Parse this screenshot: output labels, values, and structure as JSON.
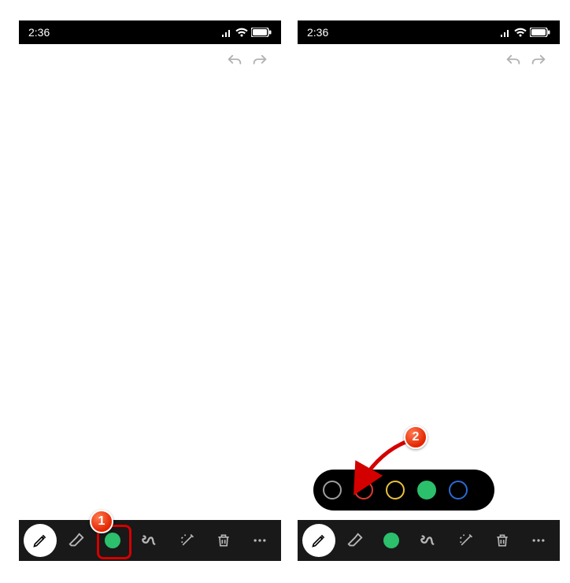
{
  "statusbar": {
    "time": "2:36"
  },
  "toolbar": {
    "tools": [
      "pencil",
      "eraser",
      "color",
      "squiggle",
      "magic",
      "trash",
      "more"
    ],
    "current_color": "#2cbf6c"
  },
  "color_picker": {
    "options": [
      {
        "name": "black",
        "color": "#000000",
        "ring": "#9e9e9e",
        "filled": false
      },
      {
        "name": "red",
        "color": "#e03a2f",
        "ring": "#e03a2f",
        "filled": false
      },
      {
        "name": "yellow",
        "color": "#e8c23a",
        "ring": "#e8c23a",
        "filled": false
      },
      {
        "name": "green",
        "color": "#2cbf6c",
        "ring": "#2cbf6c",
        "filled": true
      },
      {
        "name": "blue",
        "color": "#2a6bd4",
        "ring": "#2a6bd4",
        "filled": false
      }
    ]
  },
  "annotations": {
    "step1": "1",
    "step2": "2"
  }
}
